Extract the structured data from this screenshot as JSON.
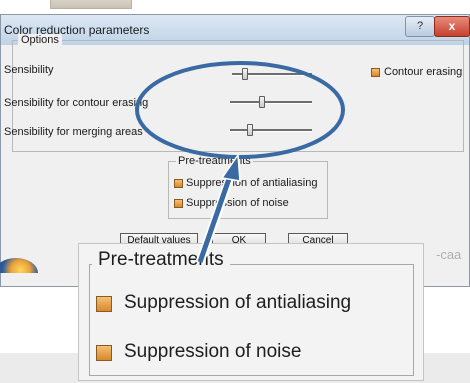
{
  "dialog": {
    "title": "Color reduction parameters",
    "help_glyph": "?",
    "close_glyph": "x"
  },
  "options": {
    "legend": "Options",
    "sensibility": {
      "label": "Sensibility",
      "level": 0.13
    },
    "contour_erasing": {
      "label": "Contour erasing",
      "checked": true
    },
    "sensibility_contour": {
      "label": "Sensibility for contour erasing",
      "level": 0.38
    },
    "sensibility_merging": {
      "label": "Sensibility for merging areas",
      "level": 0.23
    }
  },
  "pretreatments": {
    "legend": "Pre-treatments",
    "antialiasing": {
      "label": "Suppression of antialiasing",
      "checked": true
    },
    "noise": {
      "label": "Suppression of noise",
      "checked": true
    }
  },
  "buttons": {
    "default_values": "Default values",
    "ok": "OK",
    "cancel": "Cancel"
  },
  "brand_text": "-caa",
  "colors": {
    "annotation": "#3a6aa3",
    "checkbox": "#e0952e"
  }
}
